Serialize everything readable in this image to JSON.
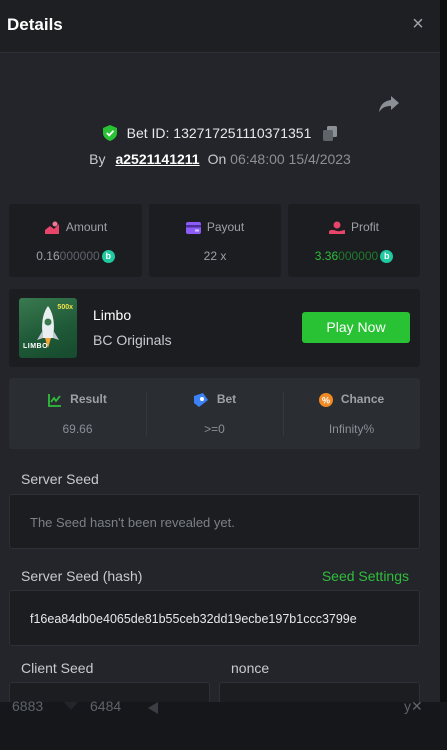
{
  "header": {
    "title": "Details",
    "close_glyph": "×"
  },
  "bet": {
    "id_label": "Bet ID: 132717251110371351",
    "by_label": "By",
    "user": "a2521141211",
    "on_label": "On",
    "time": "06:48:00 15/4/2023"
  },
  "stats": [
    {
      "label": "Amount",
      "value_main": "0.16",
      "value_dim": "000000",
      "icon": "amount-icon"
    },
    {
      "label": "Payout",
      "value": "22 x",
      "icon": "payout-icon"
    },
    {
      "label": "Profit",
      "value_main": "3.36",
      "value_dim": "000000",
      "icon": "profit-icon"
    }
  ],
  "coin_glyph": "b",
  "game": {
    "name": "Limbo",
    "provider": "BC Originals",
    "play_label": "Play Now",
    "thumb_tag": "500x",
    "thumb_word": "LIMBO"
  },
  "result": {
    "items": [
      {
        "label": "Result",
        "value": "69.66"
      },
      {
        "label": "Bet",
        "value": ">=0"
      },
      {
        "label": "Chance",
        "value": "Infinity%"
      }
    ]
  },
  "server_seed": {
    "label": "Server Seed",
    "value": "The Seed hasn't been revealed yet."
  },
  "server_seed_hash": {
    "label": "Server Seed (hash)",
    "settings_link": "Seed Settings",
    "value": "f16ea84db0e4065de81b55ceb32dd19ecbe197b1ccc3799e"
  },
  "client_seed": {
    "label": "Client Seed",
    "nonce_label": "nonce"
  },
  "bottom": {
    "left_value": "6883",
    "right_value": "6484",
    "corner": "y✕"
  },
  "colors": {
    "accent_green": "#28c234",
    "profit_green": "#2fbe3c",
    "coin_teal": "#20c9a0"
  }
}
